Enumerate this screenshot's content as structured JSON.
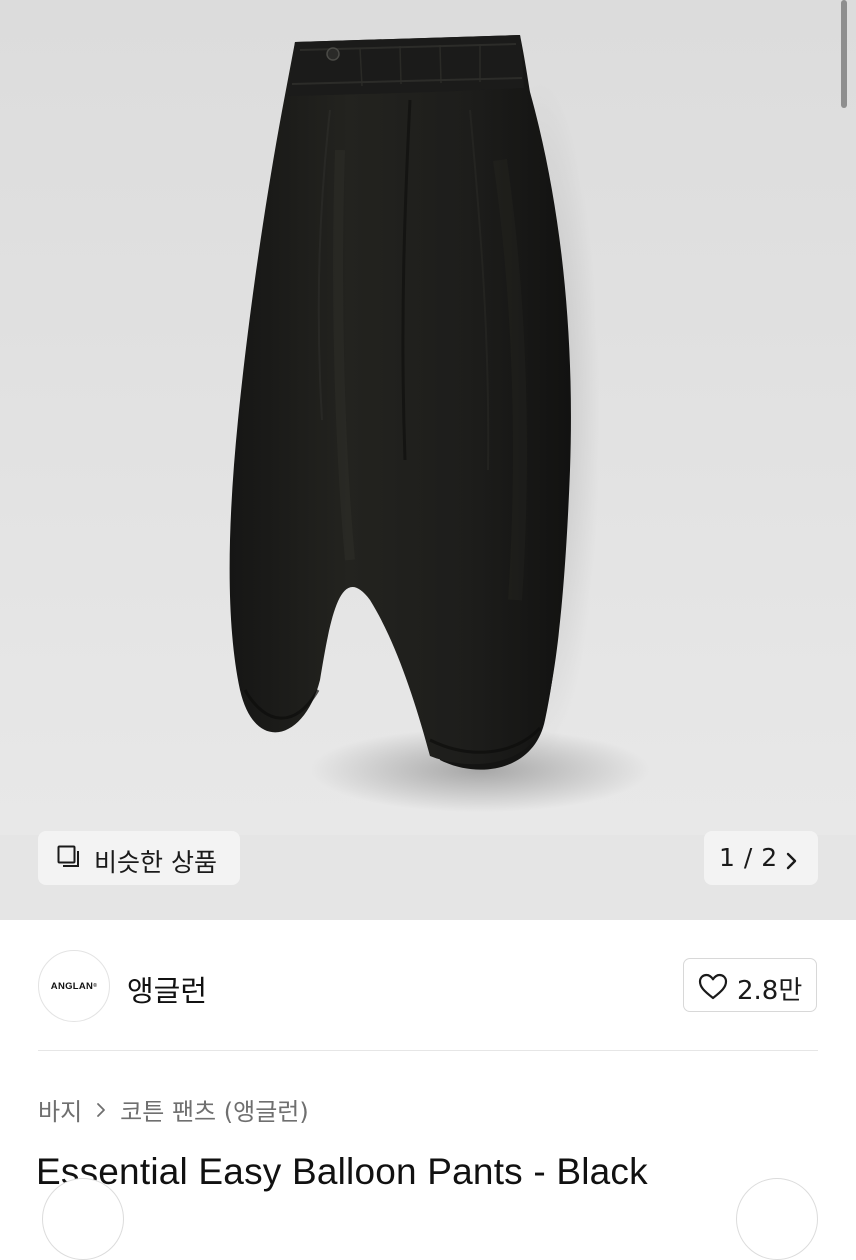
{
  "gallery": {
    "image_alt": "Essential Easy Balloon Pants - Black",
    "similar_label": "비슷한 상품",
    "similar_icon": "similar-items-icon",
    "pager": "1 / 2",
    "pager_icon": "chevron-right-icon"
  },
  "brand": {
    "logo_text": "ANGLAN",
    "name": "앵글런",
    "like_count": "2.8만",
    "like_icon": "heart-outline-icon"
  },
  "breadcrumb": {
    "category": "바지",
    "separator_icon": "chevron-right-icon",
    "subcategory": "코튼 팬츠 (앵글런)"
  },
  "product": {
    "title": "Essential Easy Balloon Pants - Black"
  },
  "colors": {
    "hero_bg": "#e1e1e1",
    "pants": "#1e1e1c",
    "text_primary": "#111111",
    "text_secondary": "#6f6f6f"
  }
}
